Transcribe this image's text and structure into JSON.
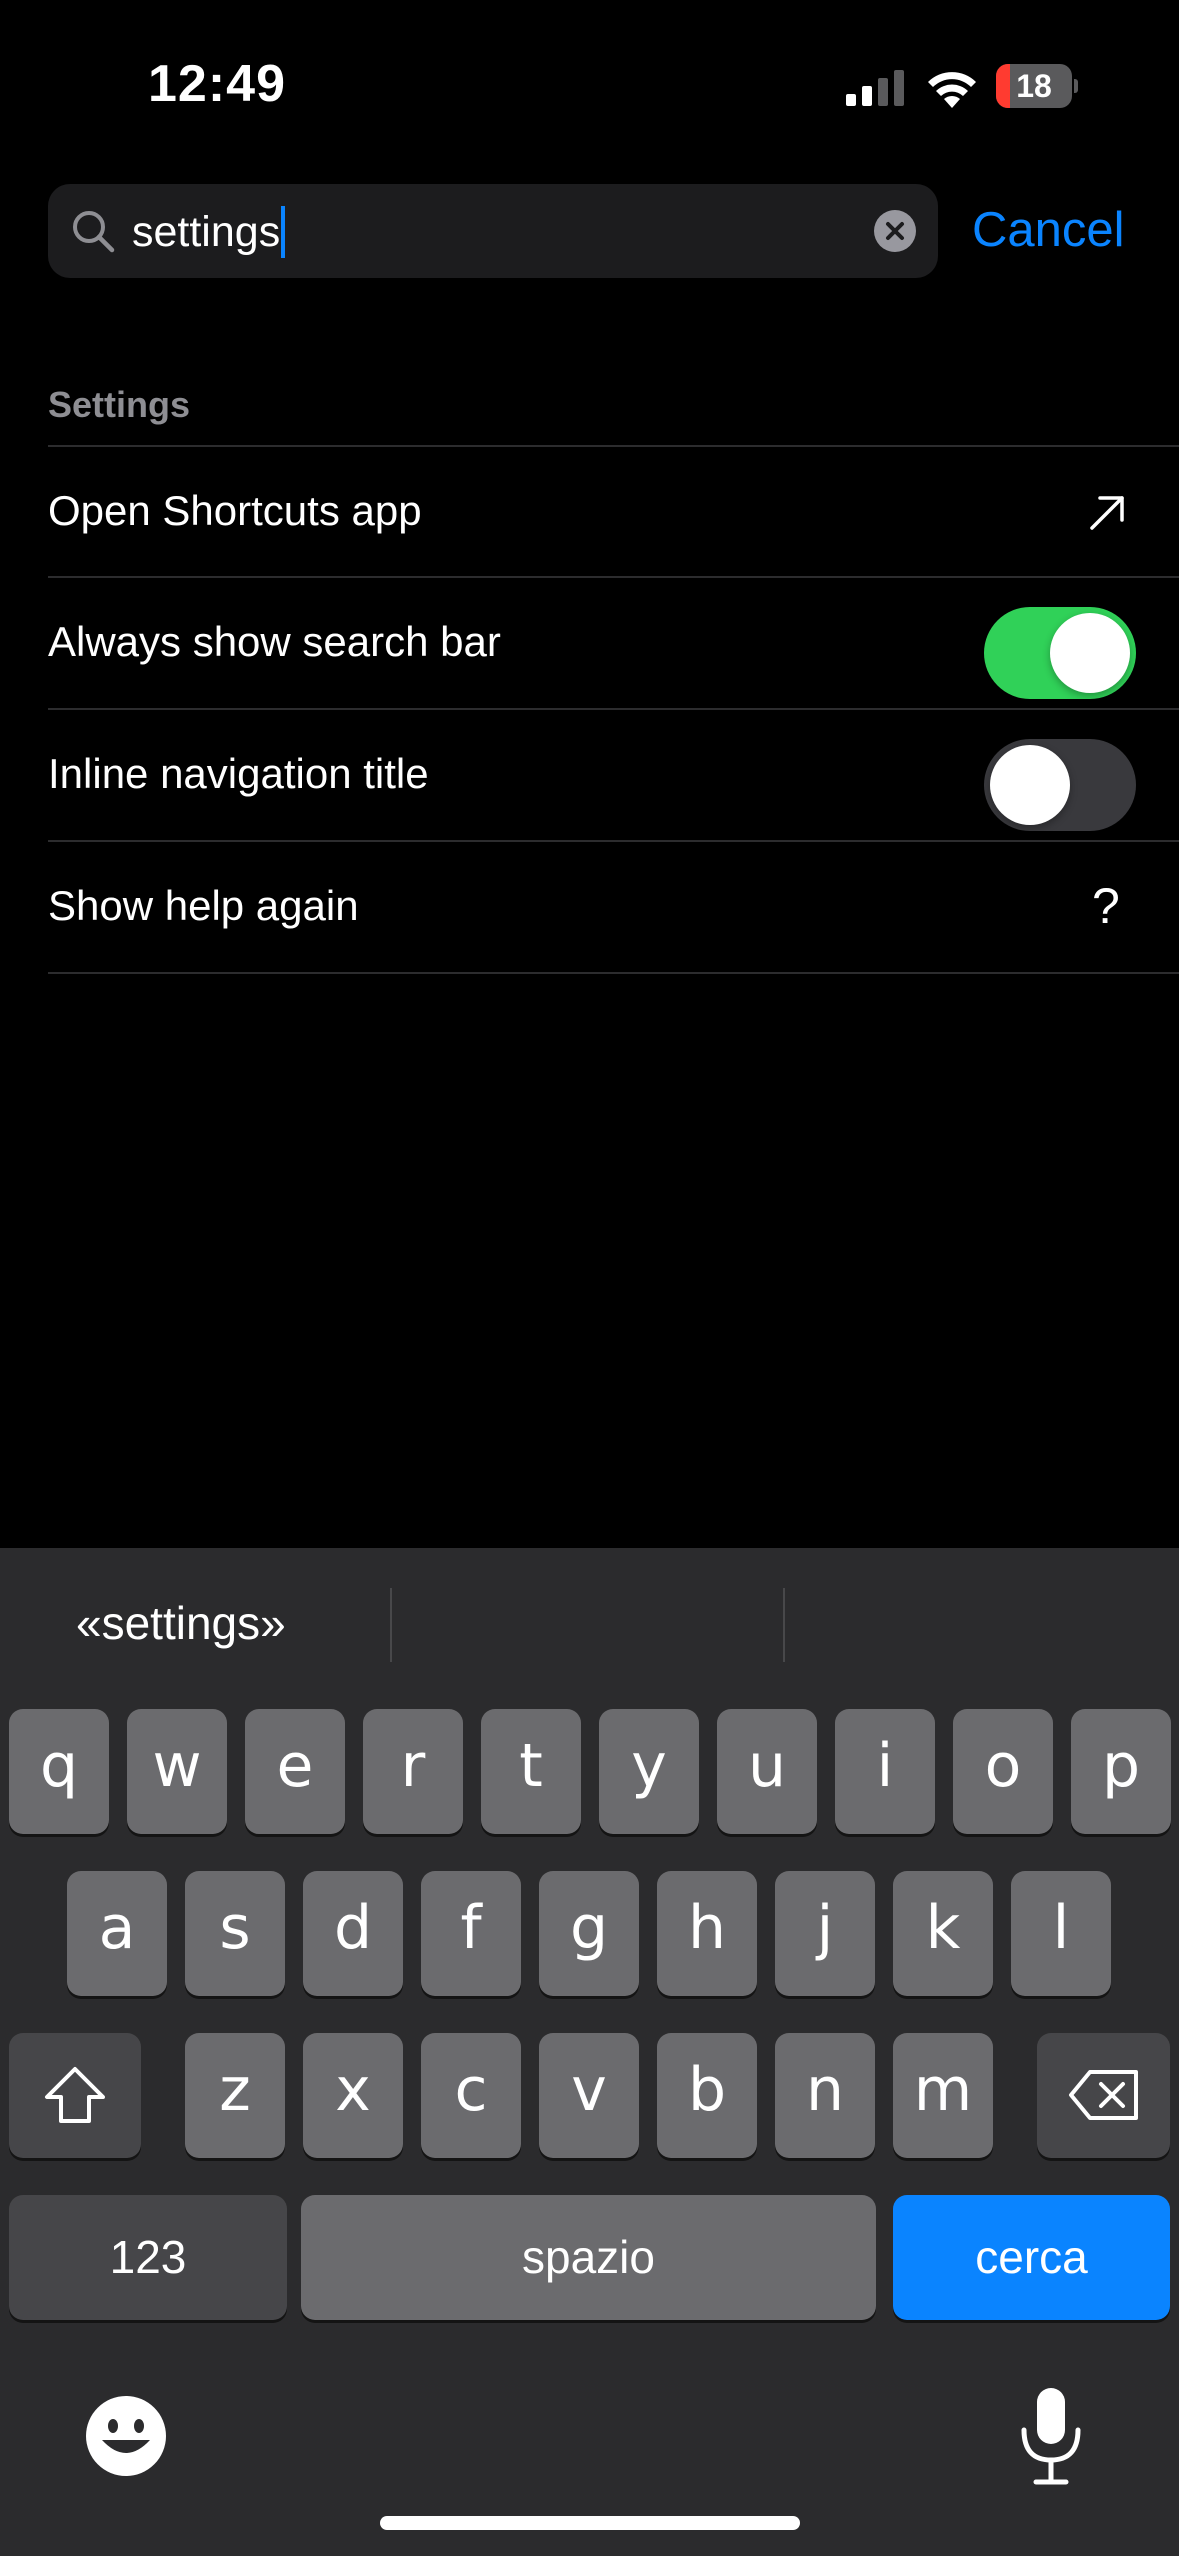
{
  "status_bar": {
    "time": "12:49",
    "battery_level": "18",
    "battery_fraction": 0.18,
    "battery_color": "#ff3b30"
  },
  "search": {
    "value": "settings",
    "cancel_label": "Cancel"
  },
  "section": {
    "header": "Settings",
    "rows": [
      {
        "label": "Open Shortcuts app",
        "accessory": "arrow-up-right-icon"
      },
      {
        "label": "Always show search bar",
        "accessory": "toggle",
        "toggle_on": true
      },
      {
        "label": "Inline navigation title",
        "accessory": "toggle",
        "toggle_on": false
      },
      {
        "label": "Show help again",
        "accessory": "question-mark-icon",
        "accessory_text": "?"
      }
    ]
  },
  "keyboard": {
    "suggestions": [
      "«settings»",
      "",
      ""
    ],
    "row1": [
      "q",
      "w",
      "e",
      "r",
      "t",
      "y",
      "u",
      "i",
      "o",
      "p"
    ],
    "row2": [
      "a",
      "s",
      "d",
      "f",
      "g",
      "h",
      "j",
      "k",
      "l"
    ],
    "row3": [
      "z",
      "x",
      "c",
      "v",
      "b",
      "n",
      "m"
    ],
    "numbers_label": "123",
    "space_label": "spazio",
    "return_label": "cerca",
    "accent_color": "#0a84ff",
    "toggle_on_color": "#30d158"
  }
}
